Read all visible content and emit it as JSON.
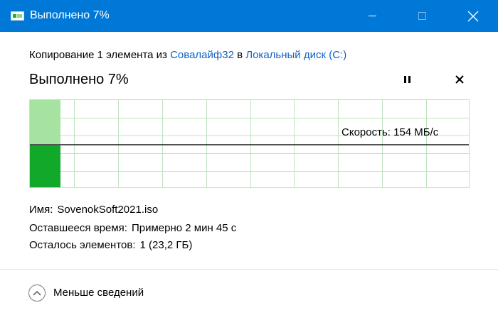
{
  "window": {
    "title": "Выполнено 7%"
  },
  "copy_line": {
    "prefix": "Копирование 1 элемента из ",
    "source": "Совалайф32",
    "middle": " в ",
    "destination": "Локальный диск (C:)"
  },
  "progress": {
    "title": "Выполнено 7%",
    "percent": 7,
    "speed_label": "Скорость: 154 МБ/с"
  },
  "details": {
    "name_label": "Имя:",
    "name_value": "SovenokSoft2021.iso",
    "time_label": "Оставшееся время:",
    "time_value": "Примерно 2 мин 45 с",
    "items_label": "Осталось элементов:",
    "items_value": "1 (23,2 ГБ)"
  },
  "footer": {
    "less_details_label": "Меньше сведений"
  },
  "colors": {
    "titlebar": "#0078d7",
    "link": "#0f62c5",
    "progress_fill_light": "#a6e3a1",
    "progress_fill_dark": "#12a829",
    "grid": "#bfe3bf"
  },
  "icons": {
    "app": "copy-progress-icon",
    "minimize": "minimize-icon",
    "maximize": "maximize-icon",
    "close": "close-icon",
    "pause": "pause-icon",
    "cancel": "cancel-icon",
    "less": "chevron-up-icon"
  }
}
